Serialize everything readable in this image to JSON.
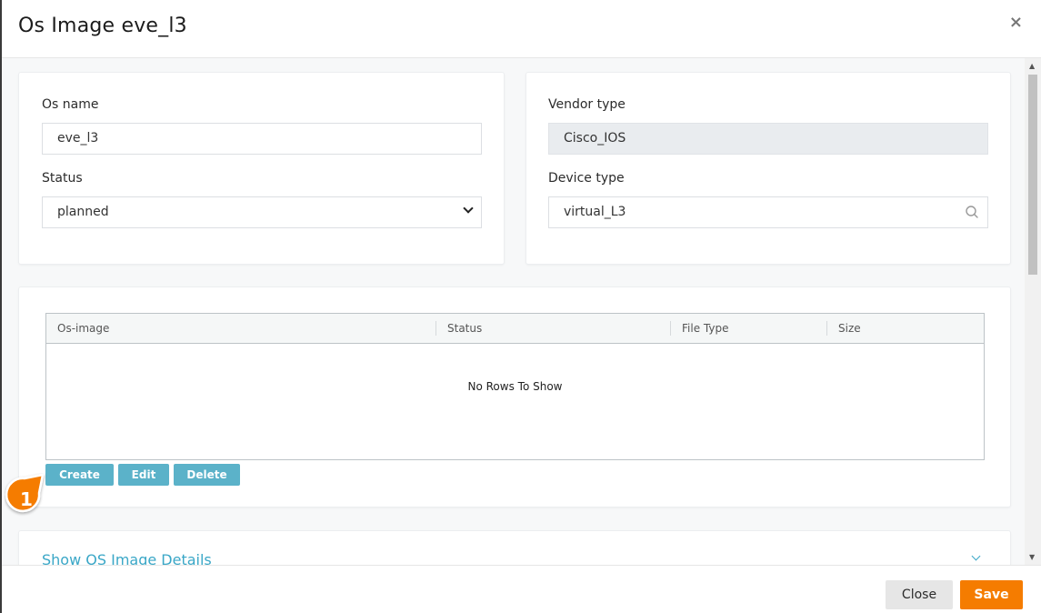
{
  "header": {
    "title": "Os Image eve_l3",
    "close_icon": "×"
  },
  "form": {
    "os_name_label": "Os name",
    "os_name_value": "eve_l3",
    "status_label": "Status",
    "status_value": "planned",
    "vendor_type_label": "Vendor type",
    "vendor_type_value": "Cisco_IOS",
    "device_type_label": "Device type",
    "device_type_value": "virtual_L3"
  },
  "grid": {
    "columns": [
      "Os-image",
      "Status",
      "File Type",
      "Size"
    ],
    "empty_text": "No Rows To Show",
    "buttons": {
      "create": "Create",
      "edit": "Edit",
      "delete": "Delete"
    }
  },
  "details": {
    "title": "Show OS Image Details"
  },
  "step_badge": {
    "number": "1",
    "color": "#f57c00"
  },
  "footer": {
    "close_label": "Close",
    "save_label": "Save"
  },
  "colors": {
    "accent": "#f57c00",
    "grid_button": "#5bb2c9",
    "link": "#3aa7c7"
  }
}
